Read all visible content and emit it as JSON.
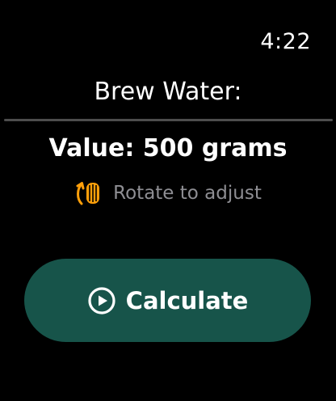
{
  "status": {
    "time": "4:22"
  },
  "screen": {
    "title": "Brew Water:",
    "value_text": "Value: 500 grams",
    "hint_icon": "digital-crown-rotate-icon",
    "hint_text": "Rotate to adjust"
  },
  "action": {
    "icon": "play-circle-icon",
    "label": "Calculate"
  },
  "colors": {
    "background": "#000000",
    "button_bg": "#17544a",
    "hint_icon": "#ff9f0a",
    "hint_text": "#8e8e93",
    "divider": "#4d4d4d"
  }
}
